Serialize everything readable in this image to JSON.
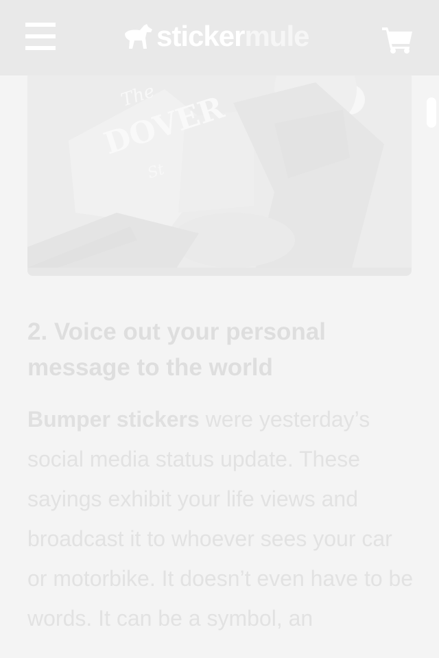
{
  "header": {
    "logo_part1": "sticker",
    "logo_part2": "mule"
  },
  "icons": {
    "menu": "hamburger-menu-icon",
    "logo": "mule-logo-icon",
    "cart": "shopping-cart-icon"
  },
  "hero": {
    "sign_text_line1": "The",
    "sign_text_line2": "DOVER",
    "sign_text_line3": "St"
  },
  "article": {
    "heading": "2. Voice out your personal message to the world",
    "link_text": "Bumper stickers",
    "body_text": " were yesterday’s social media status update. These sayings exhibit your life views and broadcast it to whoever sees your car or motorbike. It doesn’t even have to be words. It can be a symbol, an"
  },
  "colors": {
    "header_bg": "#e9e9e9",
    "page_bg": "#f4f4f4",
    "heading": "#dedede",
    "body_text": "#e2e2e2",
    "icons": "#ffffff"
  }
}
